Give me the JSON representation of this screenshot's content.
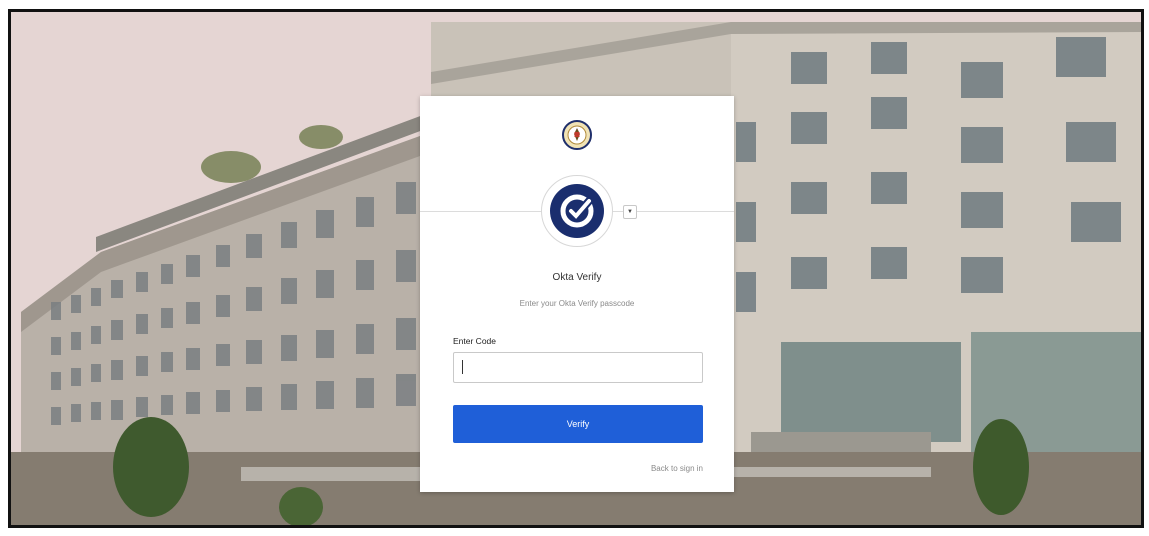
{
  "signin": {
    "factor_title": "Okta Verify",
    "factor_subtitle": "Enter your Okta Verify passcode",
    "code_label": "Enter Code",
    "code_value": "",
    "verify_label": "Verify",
    "back_link": "Back to sign in",
    "factor_icon": "okta-verify-check-icon",
    "logo_icon": "state-department-seal-icon"
  },
  "colors": {
    "primary_button": "#1f5fd8",
    "factor_icon": "#1a2e6e",
    "card_background": "#ffffff"
  }
}
